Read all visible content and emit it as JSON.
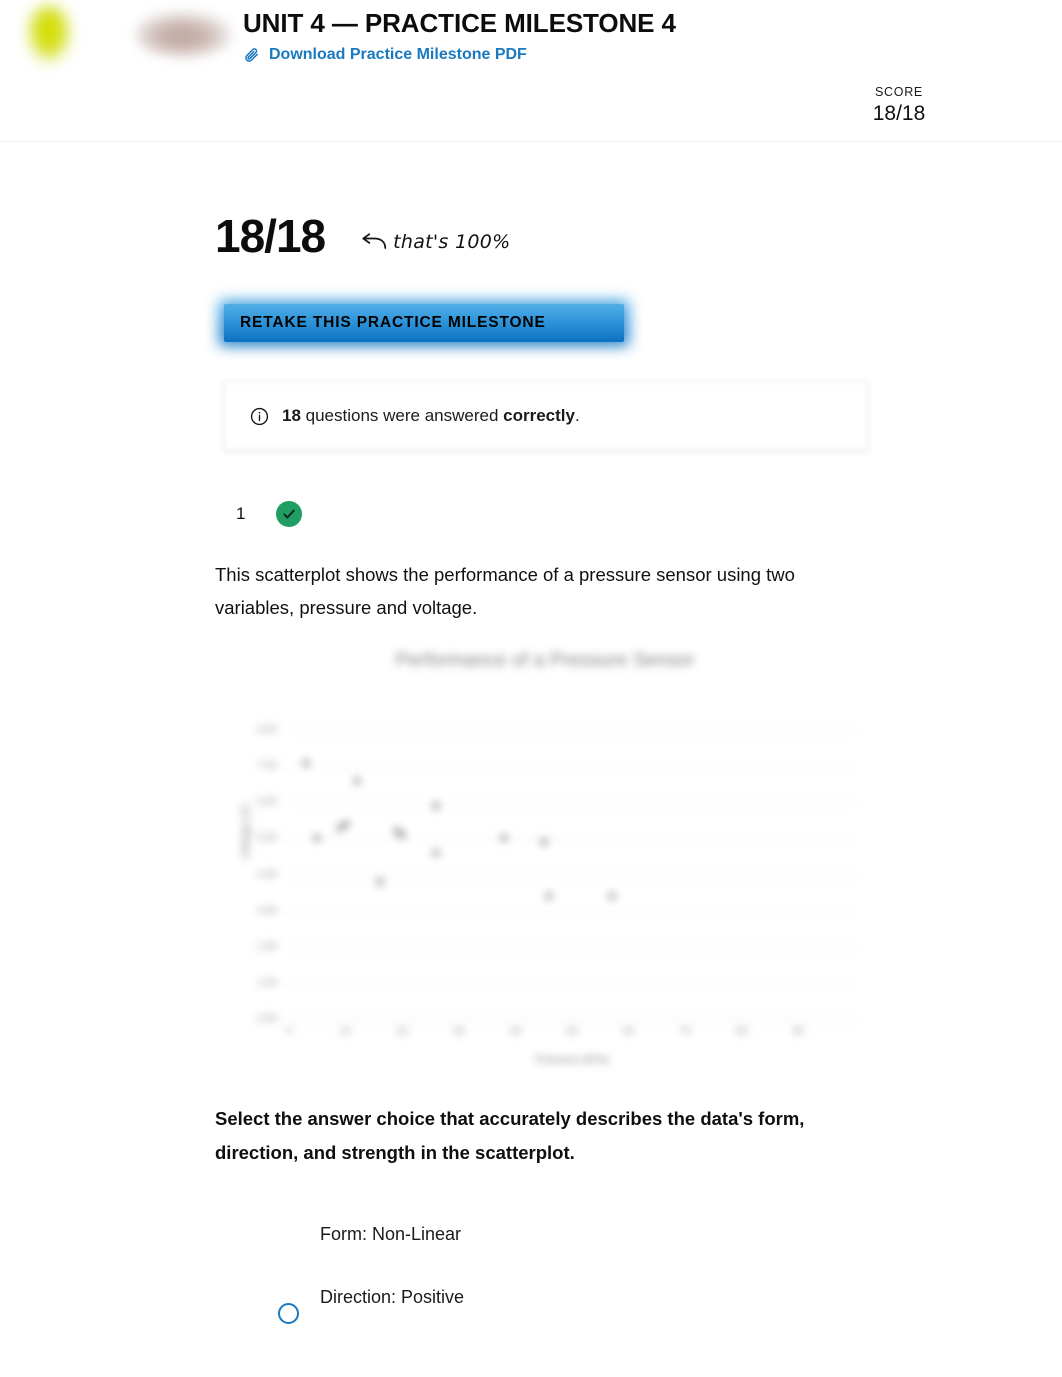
{
  "header": {
    "logo_primary": "sophia-leaf-logo",
    "logo_wordmark": "sophia-wordmark-logo",
    "title": "UNIT 4 — PRACTICE MILESTONE 4",
    "pdf_link_label": "Download Practice Milestone PDF",
    "pdf_link_icon": "paperclip-icon",
    "score_caption": "SCORE",
    "score_value": "18/18"
  },
  "summary": {
    "big_score": "18/18",
    "annotation": "that's 100%",
    "annotation_arrow": "curved-left-arrow-icon",
    "retake_label": "RETAKE THIS PRACTICE MILESTONE",
    "info_icon": "info-circle-icon",
    "info_count": "18",
    "info_middle": " questions were answered ",
    "info_emphasis": "correctly",
    "info_end": "."
  },
  "question": {
    "number": "1",
    "status_icon": "check-circle-icon",
    "status": "correct",
    "stem": "This scatterplot shows the performance of a pressure sensor using two variables, pressure and voltage.",
    "prompt": "Select the answer choice that accurately describes the data's form, direction, and strength in the scatterplot.",
    "option": {
      "selected": false,
      "line1": "Form: Non-Linear",
      "line2": "Direction: Positive"
    }
  },
  "colors": {
    "link_blue": "#1a79c0",
    "button_blue_top": "#52aee7",
    "button_blue_bottom": "#0c72c1",
    "correct_green": "#1f9d63",
    "radio_blue": "#1a79c0",
    "page_background": "#ffffff"
  },
  "chart_data": {
    "type": "scatter",
    "title": "Performance of a Pressure Sensor",
    "xlabel": "Pressure (kPa)",
    "ylabel": "Voltage (V)",
    "blurred": true,
    "grid": true,
    "legend": "none",
    "xlim": [
      0,
      100
    ],
    "ylim": [
      0,
      9
    ],
    "xticks": [
      "0",
      "10",
      "20",
      "30",
      "40",
      "50",
      "60",
      "70",
      "80",
      "90"
    ],
    "yticks": [
      "0.00",
      "1.00",
      "2.00",
      "3.00",
      "4.00",
      "5.00",
      "6.00",
      "7.00",
      "8.00"
    ],
    "points": [
      {
        "x": 3,
        "y": 7.1
      },
      {
        "x": 12,
        "y": 6.6
      },
      {
        "x": 26,
        "y": 5.9
      },
      {
        "x": 9,
        "y": 5.3
      },
      {
        "x": 10,
        "y": 5.4
      },
      {
        "x": 5,
        "y": 5.0
      },
      {
        "x": 19,
        "y": 5.2
      },
      {
        "x": 20,
        "y": 5.1
      },
      {
        "x": 38,
        "y": 5.0
      },
      {
        "x": 26,
        "y": 4.6
      },
      {
        "x": 45,
        "y": 4.9
      },
      {
        "x": 16,
        "y": 3.8
      },
      {
        "x": 46,
        "y": 3.4
      },
      {
        "x": 57,
        "y": 3.4
      }
    ]
  }
}
